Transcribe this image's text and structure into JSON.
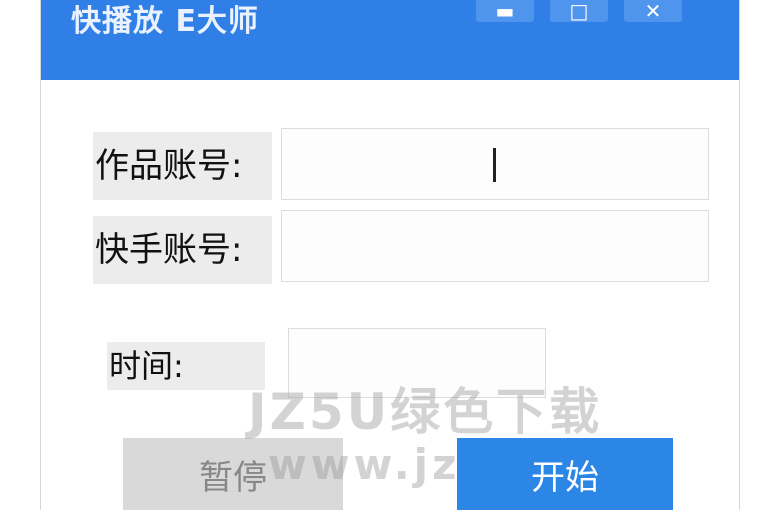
{
  "window": {
    "title": "快播放  E大师",
    "controls": {
      "minimize_glyph": "▬",
      "maximize_glyph": "□",
      "close_glyph": "✕"
    }
  },
  "form": {
    "work_account_label": "作品账号:",
    "work_account_value": "",
    "kuaishou_account_label": "快手账号:",
    "kuaishou_account_value": "",
    "time_label": "时间:",
    "time_value": ""
  },
  "buttons": {
    "pause_label": "暂停",
    "start_label": "开始"
  },
  "watermark": {
    "brand": "JZ5U绿色下载",
    "url": "www.jz"
  },
  "colors": {
    "titlebar": "#2f7fe6",
    "start_button": "#2b86e6",
    "pause_button": "#d9d9d9"
  }
}
